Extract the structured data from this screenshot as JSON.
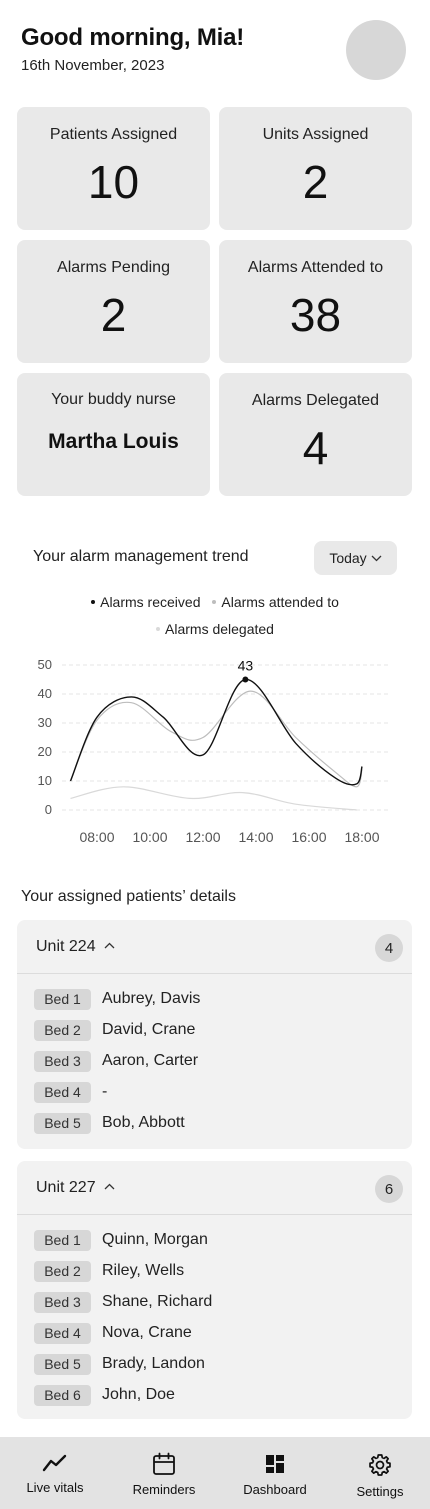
{
  "header": {
    "greeting": "Good morning, Mia!",
    "date": "16th November, 2023"
  },
  "stats": {
    "patients_assigned": {
      "label": "Patients Assigned",
      "value": "10"
    },
    "units_assigned": {
      "label": "Units Assigned",
      "value": "2"
    },
    "alarms_pending": {
      "label": "Alarms Pending",
      "value": "2"
    },
    "alarms_attended": {
      "label": "Alarms Attended to",
      "value": "38"
    },
    "buddy_nurse": {
      "label": "Your buddy nurse",
      "value": "Martha Louis"
    },
    "alarms_delegated": {
      "label": "Alarms Delegated",
      "value": "4"
    }
  },
  "trend": {
    "title": "Your alarm management trend",
    "period_select": "Today"
  },
  "chart_data": {
    "type": "line",
    "x": [
      "08:00",
      "10:00",
      "12:00",
      "14:00",
      "16:00",
      "18:00"
    ],
    "ylim": [
      0,
      50
    ],
    "yticks": [
      "0",
      "10",
      "20",
      "30",
      "40",
      "50"
    ],
    "grid": true,
    "legend_position": "top",
    "series": [
      {
        "name": "Alarms received",
        "color": "#111111",
        "points": [
          [
            7.0,
            10
          ],
          [
            8.0,
            32
          ],
          [
            9.3,
            39
          ],
          [
            10.5,
            32
          ],
          [
            12.0,
            19
          ],
          [
            13.6,
            45
          ],
          [
            15.5,
            23
          ],
          [
            17.0,
            11
          ],
          [
            17.8,
            9
          ],
          [
            18.0,
            15
          ]
        ]
      },
      {
        "name": "Alarms attended to",
        "color": "#bdbdbd",
        "points": [
          [
            7.0,
            10
          ],
          [
            8.0,
            31
          ],
          [
            9.3,
            37
          ],
          [
            10.8,
            27
          ],
          [
            12.0,
            25
          ],
          [
            13.8,
            41
          ],
          [
            15.5,
            25
          ],
          [
            17.0,
            13
          ],
          [
            17.8,
            8
          ],
          [
            18.0,
            14
          ]
        ]
      },
      {
        "name": "Alarms delegated",
        "color": "#d9d9d9",
        "points": [
          [
            7.0,
            4
          ],
          [
            9.0,
            8
          ],
          [
            11.5,
            4
          ],
          [
            13.5,
            6
          ],
          [
            15.5,
            2
          ],
          [
            17.8,
            0
          ]
        ]
      }
    ],
    "annotation": {
      "x": 13.6,
      "y": 45,
      "label": "43"
    }
  },
  "patients": {
    "title": "Your assigned patients’ details",
    "units": [
      {
        "name": "Unit 224",
        "count": "4",
        "beds": [
          {
            "bed": "Bed 1",
            "patient": "Aubrey, Davis"
          },
          {
            "bed": "Bed 2",
            "patient": "David, Crane"
          },
          {
            "bed": "Bed 3",
            "patient": "Aaron, Carter"
          },
          {
            "bed": "Bed 4",
            "patient": "-"
          },
          {
            "bed": "Bed 5",
            "patient": "Bob, Abbott"
          }
        ]
      },
      {
        "name": "Unit 227",
        "count": "6",
        "beds": [
          {
            "bed": "Bed 1",
            "patient": "Quinn, Morgan"
          },
          {
            "bed": "Bed 2",
            "patient": "Riley, Wells"
          },
          {
            "bed": "Bed 3",
            "patient": "Shane, Richard"
          },
          {
            "bed": "Bed 4",
            "patient": "Nova, Crane"
          },
          {
            "bed": "Bed 5",
            "patient": "Brady, Landon"
          },
          {
            "bed": "Bed 6",
            "patient": "John, Doe"
          }
        ]
      }
    ]
  },
  "nav": {
    "items": [
      {
        "label": "Live vitals",
        "icon": "trend-line-icon"
      },
      {
        "label": "Reminders",
        "icon": "calendar-icon"
      },
      {
        "label": "Dashboard",
        "icon": "dashboard-icon"
      },
      {
        "label": "Settings",
        "icon": "gear-icon"
      }
    ]
  }
}
